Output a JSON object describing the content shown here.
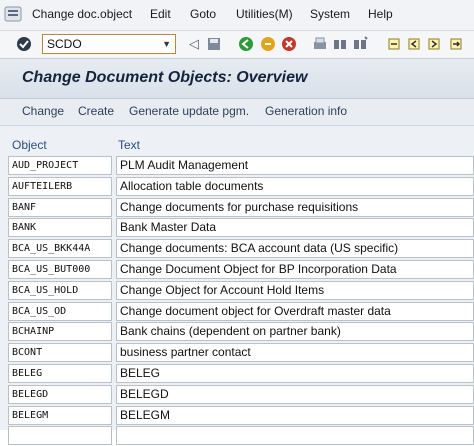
{
  "menu": {
    "items": [
      {
        "label": "Change doc.object"
      },
      {
        "label": "Edit"
      },
      {
        "label": "Goto"
      },
      {
        "label": "Utilities(M)"
      },
      {
        "label": "System"
      },
      {
        "label": "Help"
      }
    ]
  },
  "toolbar": {
    "command_value": "SCDO"
  },
  "page": {
    "title": "Change Document Objects: Overview"
  },
  "app_toolbar": {
    "buttons": [
      {
        "label": "Change"
      },
      {
        "label": "Create"
      },
      {
        "label": "Generate update pgm."
      },
      {
        "label": "Generation info"
      }
    ]
  },
  "table": {
    "columns": [
      "Object",
      "Text"
    ],
    "rows": [
      {
        "object": "AUD_PROJECT",
        "text": "PLM Audit Management"
      },
      {
        "object": "AUFTEILERB",
        "text": "Allocation table documents"
      },
      {
        "object": "BANF",
        "text": "Change documents for purchase requisitions"
      },
      {
        "object": "BANK",
        "text": "Bank Master Data"
      },
      {
        "object": "BCA_US_BKK44A",
        "text": "Change documents: BCA account data (US specific)"
      },
      {
        "object": "BCA_US_BUT000",
        "text": "Change Document Object for BP Incorporation Data"
      },
      {
        "object": "BCA_US_HOLD",
        "text": "Change Object for Account Hold Items"
      },
      {
        "object": "BCA_US_OD",
        "text": "Change document object for Overdraft master data"
      },
      {
        "object": "BCHAINP",
        "text": "Bank chains (dependent on partner bank)"
      },
      {
        "object": "BCONT",
        "text": "business partner contact"
      },
      {
        "object": "BELEG",
        "text": "BELEG"
      },
      {
        "object": "BELEGD",
        "text": "BELEGD"
      },
      {
        "object": "BELEGM",
        "text": "BELEGM"
      },
      {
        "object": "",
        "text": ""
      }
    ]
  }
}
